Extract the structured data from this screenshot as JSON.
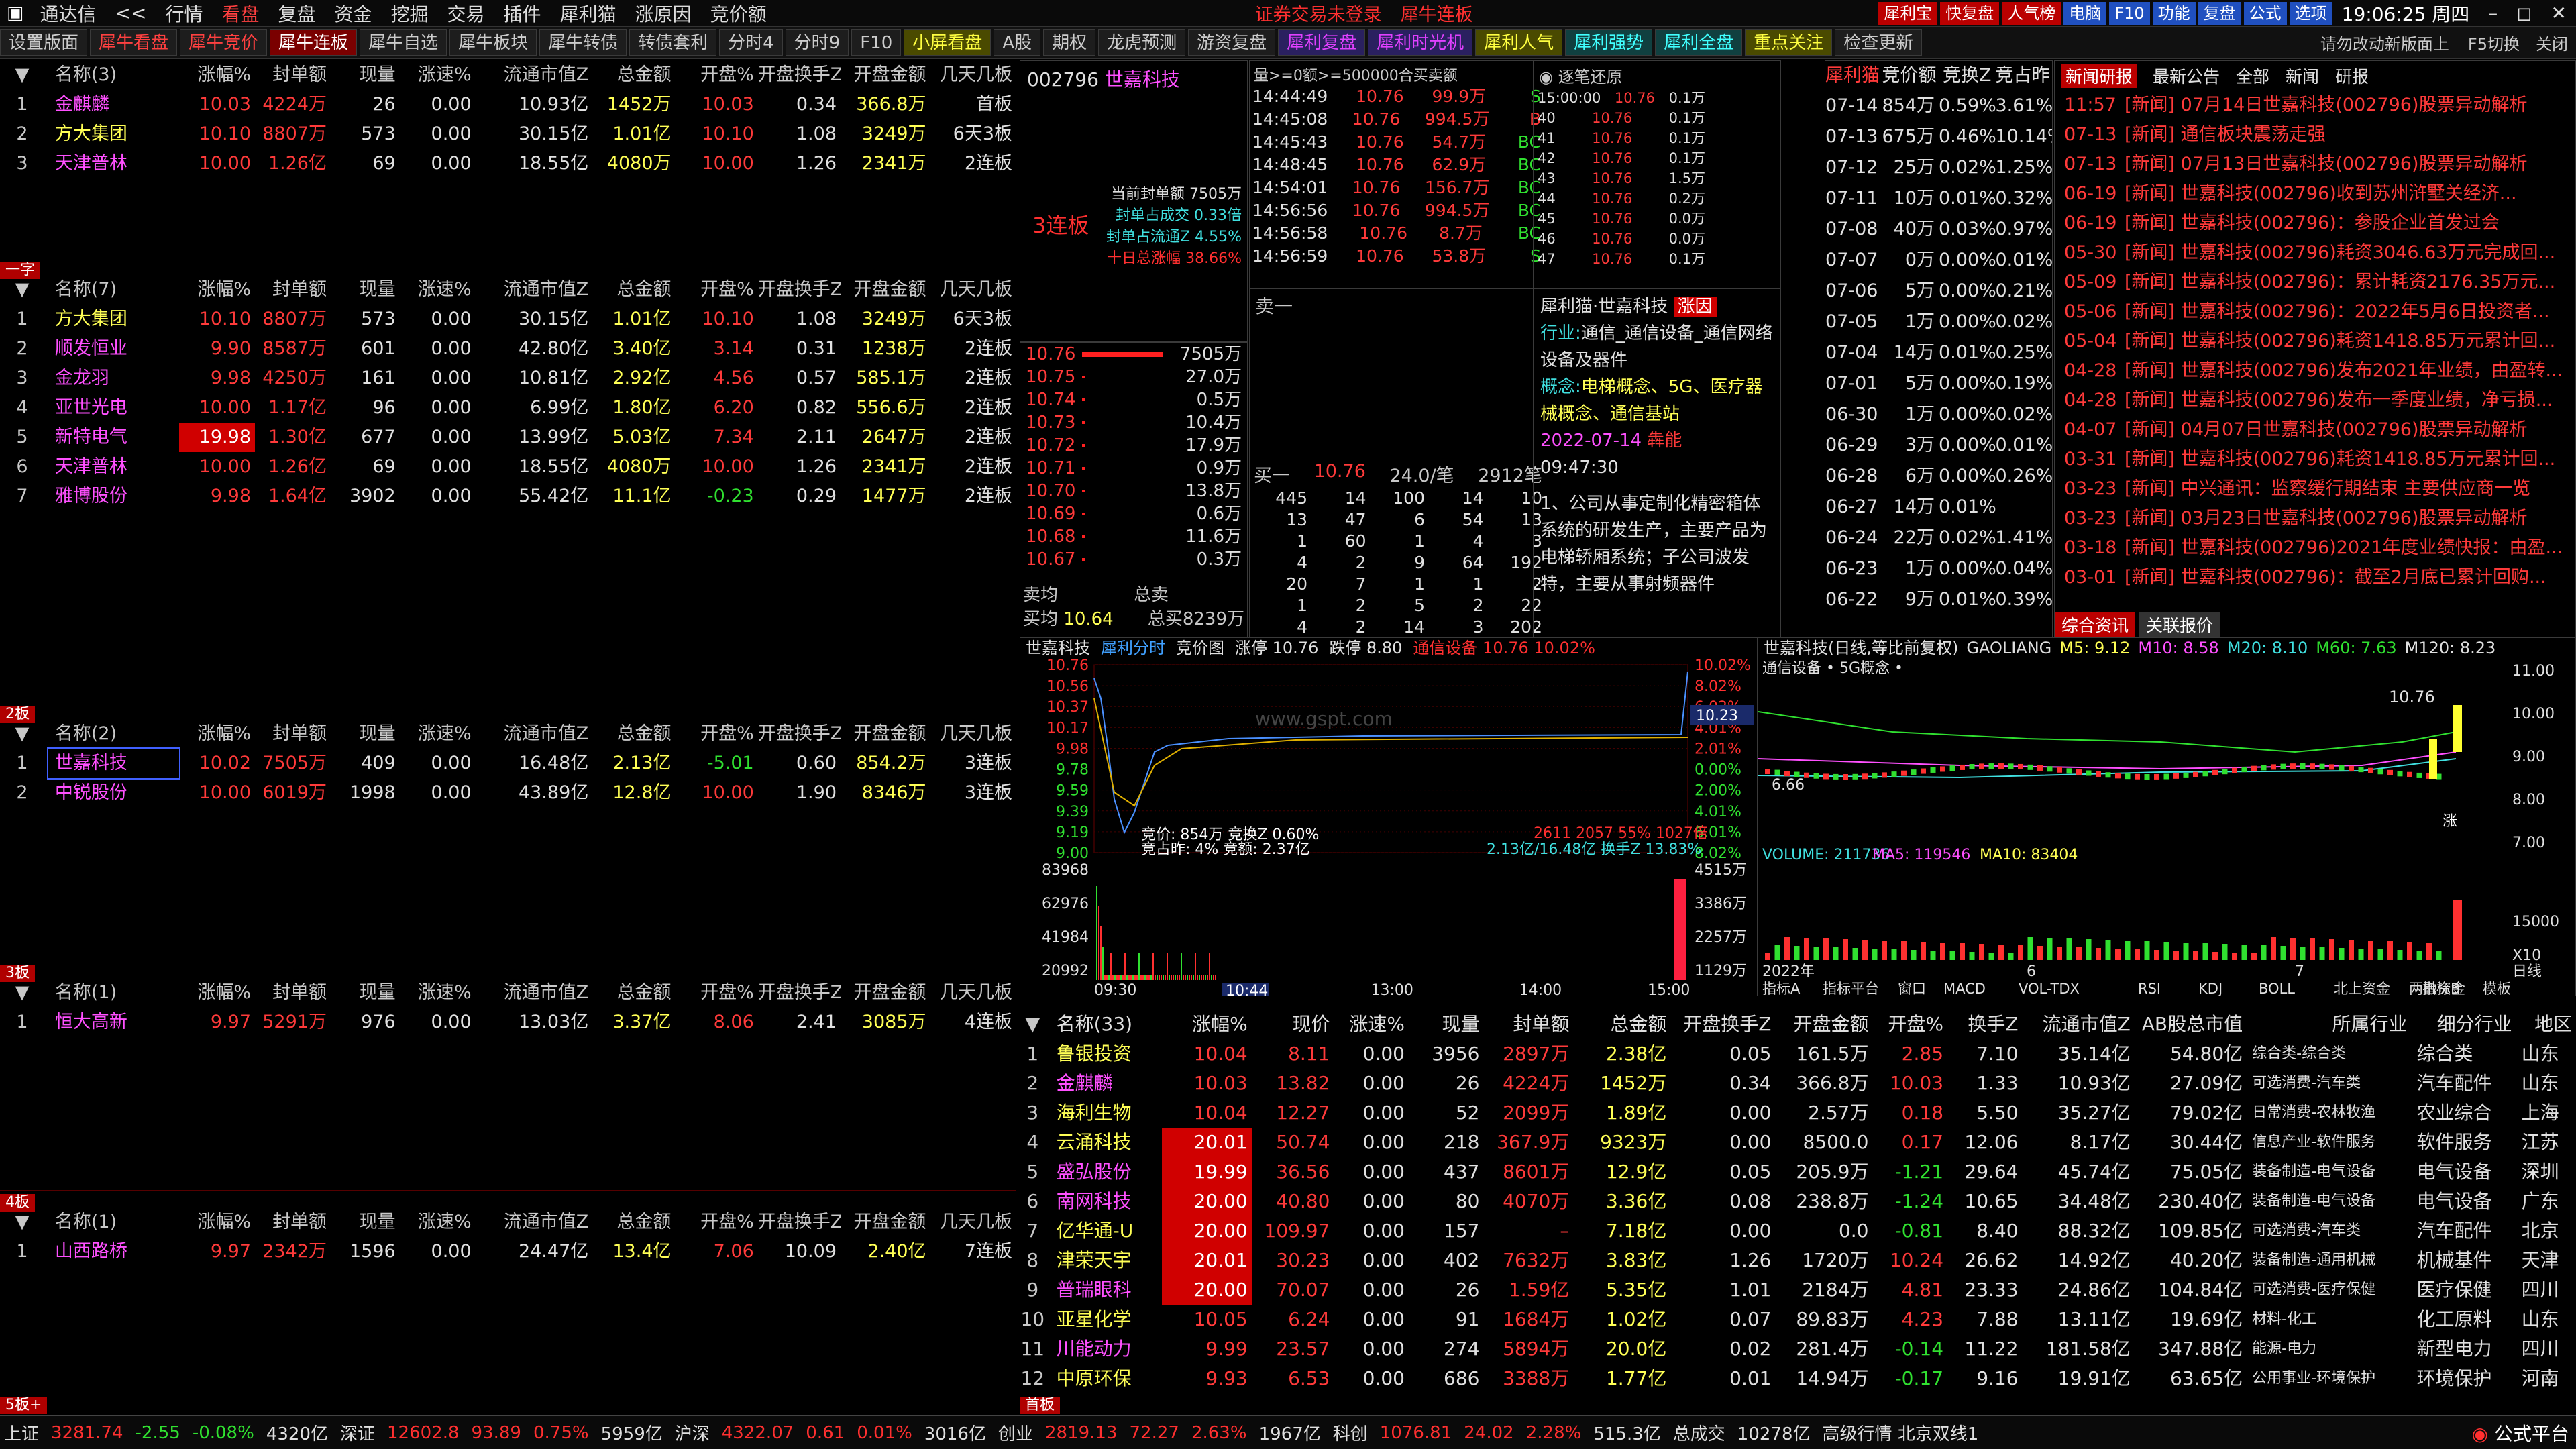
{
  "menubar": {
    "app": "通达信",
    "arrows": "<<",
    "items": [
      "行情",
      "看盘",
      "复盘",
      "资金",
      "挖掘",
      "交易",
      "插件",
      "犀利猫",
      "涨原因",
      "竞价额"
    ],
    "notice": "证券交易未登录",
    "title": "犀牛连板",
    "right_items": [
      "犀利宝",
      "快复盘",
      "人气榜",
      "电脑",
      "F10",
      "功能",
      "复盘",
      "公式",
      "选项"
    ],
    "time": "19:06:25 周四"
  },
  "tabs": [
    "设置版面",
    "犀牛看盘",
    "犀牛竞价",
    "犀牛连板",
    "犀牛自选",
    "犀牛板块",
    "犀牛转债",
    "转债套利",
    "分时4",
    "分时9",
    "F10",
    "小屏看盘",
    "A股",
    "期权",
    "龙虎预测",
    "游资复盘",
    "犀利复盘",
    "犀利时光机",
    "犀利人气",
    "犀利强势",
    "犀利全盘",
    "重点关注",
    "检查更新"
  ],
  "right_hint": "请勿改动新版面上",
  "f5": "F5切换",
  "close_label": "关闭",
  "cols": [
    "名称",
    "涨幅%",
    "封单额",
    "现量",
    "涨速%",
    "流通市值Z",
    "总金额",
    "开盘%",
    "开盘换手Z",
    "开盘金额",
    "几天几板"
  ],
  "sections": [
    {
      "name": "名称(3)",
      "label": "",
      "rows": [
        [
          "1",
          "金麒麟",
          "10.03",
          "4224万",
          "26",
          "0.00",
          "10.93亿",
          "1452万",
          "10.03",
          "0.34",
          "366.8万",
          "首板"
        ],
        [
          "2",
          "方大集团",
          "10.10",
          "8807万",
          "573",
          "0.00",
          "30.15亿",
          "1.01亿",
          "10.10",
          "1.08",
          "3249万",
          "6天3板"
        ],
        [
          "3",
          "天津普林",
          "10.00",
          "1.26亿",
          "69",
          "0.00",
          "18.55亿",
          "4080万",
          "10.00",
          "1.26",
          "2341万",
          "2连板"
        ]
      ]
    },
    {
      "name": "名称(7)",
      "label": "一字",
      "rows": [
        [
          "1",
          "方大集团",
          "10.10",
          "8807万",
          "573",
          "0.00",
          "30.15亿",
          "1.01亿",
          "10.10",
          "1.08",
          "3249万",
          "6天3板"
        ],
        [
          "2",
          "顺发恒业",
          "9.90",
          "8587万",
          "601",
          "0.00",
          "42.80亿",
          "3.40亿",
          "3.14",
          "0.31",
          "1238万",
          "2连板"
        ],
        [
          "3",
          "金龙羽",
          "9.98",
          "4250万",
          "161",
          "0.00",
          "10.81亿",
          "2.92亿",
          "4.56",
          "0.57",
          "585.1万",
          "2连板"
        ],
        [
          "4",
          "亚世光电",
          "10.00",
          "1.17亿",
          "96",
          "0.00",
          "6.99亿",
          "1.80亿",
          "6.20",
          "0.82",
          "556.6万",
          "2连板"
        ],
        [
          "5",
          "新特电气",
          "19.98",
          "1.30亿",
          "677",
          "0.00",
          "13.99亿",
          "5.03亿",
          "7.34",
          "2.11",
          "2647万",
          "2连板"
        ],
        [
          "6",
          "天津普林",
          "10.00",
          "1.26亿",
          "69",
          "0.00",
          "18.55亿",
          "4080万",
          "10.00",
          "1.26",
          "2341万",
          "2连板"
        ],
        [
          "7",
          "雅博股份",
          "9.98",
          "1.64亿",
          "3902",
          "0.00",
          "55.42亿",
          "11.1亿",
          "-0.23",
          "0.29",
          "1477万",
          "2连板"
        ]
      ]
    },
    {
      "name": "名称(2)",
      "label": "2板",
      "rows": [
        [
          "1",
          "世嘉科技",
          "10.02",
          "7505万",
          "409",
          "0.00",
          "16.48亿",
          "2.13亿",
          "-5.01",
          "0.60",
          "854.2万",
          "3连板"
        ],
        [
          "2",
          "中锐股份",
          "10.00",
          "6019万",
          "1998",
          "0.00",
          "43.89亿",
          "12.8亿",
          "10.00",
          "1.90",
          "8346万",
          "3连板"
        ]
      ]
    },
    {
      "name": "名称(1)",
      "label": "3板",
      "rows": [
        [
          "1",
          "恒大高新",
          "9.97",
          "5291万",
          "976",
          "0.00",
          "13.03亿",
          "3.37亿",
          "8.06",
          "2.41",
          "3085万",
          "4连板"
        ]
      ]
    },
    {
      "name": "名称(1)",
      "label": "4板",
      "rows": [
        [
          "1",
          "山西路桥",
          "9.97",
          "2342万",
          "1596",
          "0.00",
          "24.47亿",
          "13.4亿",
          "7.06",
          "10.09",
          "2.40亿",
          "7连板"
        ]
      ]
    }
  ],
  "label5": "5板+",
  "stock": {
    "code": "002796",
    "name": "世嘉科技",
    "board": "3连板",
    "seal_info": [
      "当前封单额 7505万",
      "封单占成交 0.33倍",
      "封单占流通Z 4.55%",
      "十日总涨幅 38.66%"
    ],
    "asks": [
      [
        "10.76",
        "7505万"
      ],
      [
        "10.75",
        "27.0万"
      ],
      [
        "10.74",
        "0.5万"
      ],
      [
        "10.73",
        "10.4万"
      ],
      [
        "10.72",
        "17.9万"
      ],
      [
        "10.71",
        "0.9万"
      ],
      [
        "10.70",
        "13.8万"
      ],
      [
        "10.69",
        "0.6万"
      ],
      [
        "10.68",
        "11.6万"
      ],
      [
        "10.67",
        "0.3万"
      ]
    ],
    "sell1_label": "卖一",
    "buy1": [
      "买一",
      "10.76",
      "24.0/笔",
      "2912笔"
    ],
    "buy_queue": [
      [
        "445",
        "14",
        "100",
        "14",
        "10"
      ],
      [
        "13",
        "47",
        "6",
        "54",
        "13"
      ],
      [
        "1",
        "60",
        "1",
        "4",
        "3"
      ],
      [
        "4",
        "2",
        "9",
        "64",
        "192"
      ],
      [
        "20",
        "7",
        "1",
        "1",
        "2"
      ],
      [
        "1",
        "2",
        "5",
        "2",
        "22"
      ],
      [
        "4",
        "2",
        "14",
        "3",
        "202"
      ]
    ],
    "avg_sell_label": "卖均",
    "total_sell_label": "总卖",
    "avg_buy_label": "买均",
    "avg_buy": "10.64",
    "total_buy": "总买8239万"
  },
  "ticks_header": "量>=0额>=500000合买卖额",
  "ticks": [
    [
      "14:44:49",
      "10.76",
      "99.9万",
      "S"
    ],
    [
      "14:45:08",
      "10.76",
      "994.5万",
      "B"
    ],
    [
      "14:45:43",
      "10.76",
      "54.7万",
      "BC"
    ],
    [
      "14:48:45",
      "10.76",
      "62.9万",
      "BC"
    ],
    [
      "14:54:01",
      "10.76",
      "156.7万",
      "BC"
    ],
    [
      "14:56:56",
      "10.76",
      "994.5万",
      "BC"
    ],
    [
      "14:56:58",
      "10.76",
      "8.7万",
      "BC"
    ],
    [
      "14:56:59",
      "10.76",
      "53.8万",
      "S"
    ]
  ],
  "restore": {
    "title": "逐笔还原",
    "rows": [
      [
        "15:00:00",
        "10.76",
        "0.1万"
      ],
      [
        "40",
        "10.76",
        "0.1万"
      ],
      [
        "41",
        "10.76",
        "0.1万"
      ],
      [
        "42",
        "10.76",
        "0.1万"
      ],
      [
        "43",
        "10.76",
        "1.5万"
      ],
      [
        "44",
        "10.76",
        "0.2万"
      ],
      [
        "45",
        "10.76",
        "0.0万"
      ],
      [
        "46",
        "10.76",
        "0.0万"
      ],
      [
        "47",
        "10.76",
        "0.1万"
      ]
    ]
  },
  "f10": {
    "title": "犀利猫·世嘉科技",
    "reason": "涨因",
    "industry_label": "行业:",
    "industry": "通信_通信设备_通信网络设备及器件",
    "concept_label": "概念:",
    "concept": "电梯概念、5G、医疗器械概念、通信基站",
    "date": "2022-07-14",
    "tag": "犇能",
    "time": "09:47:30",
    "desc": "1、公司从事定制化精密箱体系统的研发生产，主要产品为电梯轿厢系统；子公司波发特，主要从事射频器件"
  },
  "auction": {
    "cols": [
      "犀利猫",
      "竞价额",
      "竞换Z",
      "竞占昨"
    ],
    "rows": [
      [
        "07-14",
        "854万",
        "0.59%",
        "3.61%"
      ],
      [
        "07-13",
        "675万",
        "0.46%",
        "10.14%"
      ],
      [
        "07-12",
        "25万",
        "0.02%",
        "1.25%"
      ],
      [
        "07-11",
        "10万",
        "0.01%",
        "0.32%"
      ],
      [
        "07-08",
        "40万",
        "0.03%",
        "0.97%"
      ],
      [
        "07-07",
        "0万",
        "0.00%",
        "0.01%"
      ],
      [
        "07-06",
        "5万",
        "0.00%",
        "0.21%"
      ],
      [
        "07-05",
        "1万",
        "0.00%",
        "0.02%"
      ],
      [
        "07-04",
        "14万",
        "0.01%",
        "0.25%"
      ],
      [
        "07-01",
        "5万",
        "0.00%",
        "0.19%"
      ],
      [
        "06-30",
        "1万",
        "0.00%",
        "0.02%"
      ],
      [
        "06-29",
        "3万",
        "0.00%",
        "0.01%"
      ],
      [
        "06-28",
        "6万",
        "0.00%",
        "0.26%"
      ],
      [
        "06-27",
        "14万",
        "0.01%",
        ""
      ],
      [
        "06-24",
        "22万",
        "0.02%",
        "1.41%"
      ],
      [
        "06-23",
        "1万",
        "0.00%",
        "0.04%"
      ],
      [
        "06-22",
        "9万",
        "0.01%",
        "0.39%"
      ]
    ]
  },
  "news": {
    "tabs": [
      "新闻研报",
      "最新公告",
      "全部",
      "新闻",
      "研报"
    ],
    "rows": [
      [
        "11:57",
        "[新闻] 07月14日世嘉科技(002796)股票异动解析"
      ],
      [
        "07-13",
        "[新闻] 通信板块震荡走强"
      ],
      [
        "07-13",
        "[新闻] 07月13日世嘉科技(002796)股票异动解析"
      ],
      [
        "06-19",
        "[新闻] 世嘉科技(002796)收到苏州浒墅关经济..."
      ],
      [
        "06-19",
        "[新闻] 世嘉科技(002796)：参股企业首发过会"
      ],
      [
        "05-30",
        "[新闻] 世嘉科技(002796)耗资3046.63万元完成回..."
      ],
      [
        "05-09",
        "[新闻] 世嘉科技(002796)：累计耗资2176.35万元..."
      ],
      [
        "05-06",
        "[新闻] 世嘉科技(002796)：2022年5月6日投资者..."
      ],
      [
        "05-04",
        "[新闻] 世嘉科技(002796)耗资1418.85万元累计回..."
      ],
      [
        "04-28",
        "[新闻] 世嘉科技(002796)发布2021年业绩，由盈转..."
      ],
      [
        "04-28",
        "[新闻] 世嘉科技(002796)发布一季度业绩，净亏损..."
      ],
      [
        "04-07",
        "[新闻] 04月07日世嘉科技(002796)股票异动解析"
      ],
      [
        "03-31",
        "[新闻] 世嘉科技(002796)耗资1418.85万元累计回..."
      ],
      [
        "03-23",
        "[新闻] 中兴通讯：监察缓行期结束 主要供应商一览"
      ],
      [
        "03-23",
        "[新闻] 03月23日世嘉科技(002796)股票异动解析"
      ],
      [
        "03-18",
        "[新闻] 世嘉科技(002796)2021年度业绩快报：由盈..."
      ],
      [
        "03-01",
        "[新闻] 世嘉科技(002796)：截至2月底已累计回购..."
      ]
    ],
    "bottom_tabs": [
      "综合资讯",
      "关联报价"
    ]
  },
  "intraday": {
    "header": [
      "世嘉科技",
      "犀利分时",
      "竞价图",
      "涨停 10.76",
      "跌停 8.80",
      "通信设备 10.76 10.02%"
    ],
    "watermark": "www.gspt.com",
    "yleft": [
      "10.76",
      "10.56",
      "10.37",
      "10.17",
      "9.98",
      "9.78",
      "9.59",
      "9.39",
      "9.19",
      "9.00"
    ],
    "yright": [
      "10.02%",
      "8.02%",
      "6.02%",
      "4.01%",
      "2.01%",
      "0.00%",
      "2.00%",
      "4.01%",
      "6.01%",
      "8.02%"
    ],
    "cur": "10.23",
    "bid_info": "竞价: 854万 竞换Z 0.60%",
    "bid_info2": "竞占昨: 4% 竞额: 2.37亿",
    "vol_info": "2.13亿/16.48亿 换手Z 13.83%",
    "vol_info0": "2611  2057  55%  1027倍",
    "vleft": [
      "83968",
      "62976",
      "41984",
      "20992"
    ],
    "vright": [
      "4515万",
      "3386万",
      "2257万",
      "1129万"
    ],
    "times": [
      "09:30",
      "10:30",
      "13:00",
      "14:00",
      "15:00"
    ],
    "cursor_time": "10:44"
  },
  "daily": {
    "header": [
      "世嘉科技(日线,等比前复权)",
      "GAOLIANG",
      "M5: 9.12",
      "M10: 8.58",
      "M20: 8.10",
      "M60: 7.63",
      "M120: 8.23"
    ],
    "sub": "通信设备 • 5G概念 •",
    "price": "10.76",
    "low": "6.66",
    "right": [
      "11.00",
      "10.00",
      "9.00",
      "8.00",
      "7.00"
    ],
    "vol_header": [
      "VOLUME: 211736",
      "MA5: 119546",
      "MA10: 83404"
    ],
    "vol_right": [
      "15000",
      "X10"
    ],
    "dates": [
      "2022年",
      "6",
      "7"
    ],
    "zhang": "涨",
    "period": "日线",
    "bottom_tabs": [
      "指标A",
      "指标平台",
      "窗口",
      "MACD",
      "VOL-TDX",
      "RSI",
      "KDJ",
      "BOLL",
      "北上资金",
      "两融资金",
      "指标B",
      "模板"
    ]
  },
  "bottom": {
    "cols": [
      "名称(33)",
      "涨幅%",
      "现价",
      "涨速%",
      "现量",
      "封单额",
      "总金额",
      "开盘换手Z",
      "开盘金额",
      "开盘%",
      "换手Z",
      "流通市值Z",
      "AB股总市值",
      "所属行业",
      "细分行业",
      "地区"
    ],
    "rows": [
      [
        "1",
        "鲁银投资",
        "10.04",
        "8.11",
        "0.00",
        "3956",
        "2897万",
        "2.38亿",
        "0.05",
        "161.5万",
        "2.85",
        "7.10",
        "35.14亿",
        "54.80亿",
        "综合类-综合类",
        "综合类",
        "山东"
      ],
      [
        "2",
        "金麒麟",
        "10.03",
        "13.82",
        "0.00",
        "26",
        "4224万",
        "1452万",
        "0.34",
        "366.8万",
        "10.03",
        "1.33",
        "10.93亿",
        "27.09亿",
        "可选消费-汽车类",
        "汽车配件",
        "山东"
      ],
      [
        "3",
        "海利生物",
        "10.04",
        "12.27",
        "0.00",
        "52",
        "2099万",
        "1.89亿",
        "0.00",
        "2.57万",
        "0.18",
        "5.50",
        "35.27亿",
        "79.02亿",
        "日常消费-农林牧渔",
        "农业综合",
        "上海"
      ],
      [
        "4",
        "云涌科技",
        "20.01",
        "50.74",
        "0.00",
        "218",
        "367.9万",
        "9323万",
        "0.00",
        "8500.0",
        "0.17",
        "12.06",
        "8.17亿",
        "30.44亿",
        "信息产业-软件服务",
        "软件服务",
        "江苏"
      ],
      [
        "5",
        "盛弘股份",
        "19.99",
        "36.56",
        "0.00",
        "437",
        "8601万",
        "12.9亿",
        "0.05",
        "205.9万",
        "-1.21",
        "29.64",
        "45.74亿",
        "75.05亿",
        "装备制造-电气设备",
        "电气设备",
        "深圳"
      ],
      [
        "6",
        "南网科技",
        "20.00",
        "40.80",
        "0.00",
        "80",
        "4070万",
        "3.36亿",
        "0.08",
        "238.8万",
        "-1.24",
        "10.65",
        "34.48亿",
        "230.40亿",
        "装备制造-电气设备",
        "电气设备",
        "广东"
      ],
      [
        "7",
        "亿华通-U",
        "20.00",
        "109.97",
        "0.00",
        "157",
        "–",
        "7.18亿",
        "0.00",
        "0.0",
        "-0.81",
        "8.40",
        "88.32亿",
        "109.85亿",
        "可选消费-汽车类",
        "汽车配件",
        "北京"
      ],
      [
        "8",
        "津荣天宇",
        "20.01",
        "30.23",
        "0.00",
        "402",
        "7632万",
        "3.83亿",
        "1.26",
        "1720万",
        "10.24",
        "26.62",
        "14.92亿",
        "40.20亿",
        "装备制造-通用机械",
        "机械基件",
        "天津"
      ],
      [
        "9",
        "普瑞眼科",
        "20.00",
        "70.07",
        "0.00",
        "26",
        "1.59亿",
        "5.35亿",
        "1.01",
        "2184万",
        "4.81",
        "23.33",
        "24.86亿",
        "104.84亿",
        "可选消费-医疗保健",
        "医疗保健",
        "四川"
      ],
      [
        "10",
        "亚星化学",
        "10.05",
        "6.24",
        "0.00",
        "91",
        "1684万",
        "1.02亿",
        "0.07",
        "89.83万",
        "4.23",
        "7.88",
        "13.11亿",
        "19.69亿",
        "材料-化工",
        "化工原料",
        "山东"
      ],
      [
        "11",
        "川能动力",
        "9.99",
        "23.57",
        "0.00",
        "274",
        "5894万",
        "20.0亿",
        "0.02",
        "281.4万",
        "-0.14",
        "11.22",
        "181.58亿",
        "347.88亿",
        "能源-电力",
        "新型电力",
        "四川"
      ],
      [
        "12",
        "中原环保",
        "9.93",
        "6.53",
        "0.00",
        "686",
        "3388万",
        "1.77亿",
        "0.01",
        "14.94万",
        "-0.17",
        "9.16",
        "19.91亿",
        "63.65亿",
        "公用事业-环境保护",
        "环境保护",
        "河南"
      ]
    ],
    "label": "首板"
  },
  "status": [
    "上证",
    "3281.74",
    "-2.55",
    "-0.08%",
    "4320亿",
    "深证",
    "12602.8",
    "93.89",
    "0.75%",
    "5959亿",
    "沪深",
    "4322.07",
    "0.61",
    "0.01%",
    "3016亿",
    "创业",
    "2819.13",
    "72.27",
    "2.63%",
    "1967亿",
    "科创",
    "1076.81",
    "24.02",
    "2.28%",
    "515.3亿",
    "总成交",
    "10278亿",
    "高级行情 北京双线1"
  ],
  "brand": "公式平台"
}
